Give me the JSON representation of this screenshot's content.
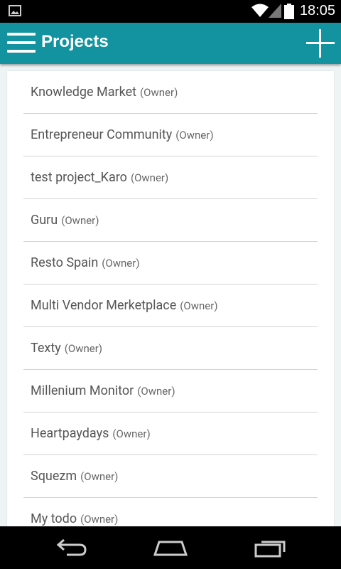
{
  "status_bar": {
    "time": "18:05",
    "icons": [
      "image-icon",
      "wifi-icon",
      "signal-icon",
      "battery-icon"
    ]
  },
  "app_bar": {
    "title": "Projects",
    "menu_icon": "hamburger-icon",
    "add_icon": "plus-icon",
    "color": "#12939f"
  },
  "projects": [
    {
      "name": "Knowledge Market",
      "role": "(Owner)"
    },
    {
      "name": "Entrepreneur Community",
      "role": "(Owner)"
    },
    {
      "name": "test project_Karo",
      "role": "(Owner)"
    },
    {
      "name": "Guru",
      "role": "(Owner)"
    },
    {
      "name": "Resto Spain",
      "role": "(Owner)"
    },
    {
      "name": "Multi Vendor Merketplace",
      "role": "(Owner)"
    },
    {
      "name": "Texty",
      "role": "(Owner)"
    },
    {
      "name": "Millenium Monitor",
      "role": "(Owner)"
    },
    {
      "name": "Heartpaydays",
      "role": "(Owner)"
    },
    {
      "name": "Squezm",
      "role": "(Owner)"
    },
    {
      "name": "My todo",
      "role": "(Owner)"
    }
  ],
  "nav_bar": {
    "icons": [
      "back-icon",
      "home-icon",
      "recent-apps-icon"
    ]
  }
}
